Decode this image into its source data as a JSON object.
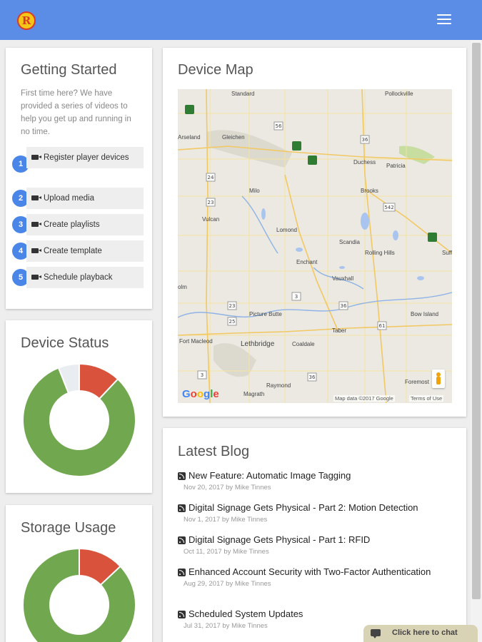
{
  "header": {
    "logo_letter": "R",
    "brand_color": "#5b8de6",
    "menu_icon": "hamburger-menu-icon"
  },
  "getting_started": {
    "title": "Getting Started",
    "description": "First time here? We have provided a series of videos to help you get up and running in no time.",
    "steps": [
      {
        "number": "1",
        "label": "Register player devices"
      },
      {
        "number": "2",
        "label": "Upload media"
      },
      {
        "number": "3",
        "label": "Create playlists"
      },
      {
        "number": "4",
        "label": "Create template"
      },
      {
        "number": "5",
        "label": "Schedule playback"
      }
    ]
  },
  "device_status": {
    "title": "Device Status",
    "segments": [
      {
        "fraction": 0.12,
        "color": "#d9533c"
      },
      {
        "fraction": 0.82,
        "color": "#71a84f"
      },
      {
        "fraction": 0.06,
        "color": "#e9ecf0"
      }
    ]
  },
  "storage_usage": {
    "title": "Storage Usage",
    "segments": [
      {
        "fraction": 0.13,
        "color": "#d9533c"
      },
      {
        "fraction": 0.87,
        "color": "#71a84f"
      }
    ]
  },
  "device_map": {
    "title": "Device Map",
    "towns": [
      "Standard",
      "Pollockville",
      "Gleichen",
      "Duchess",
      "Patricia",
      "Milo",
      "Brooks",
      "Vulcan",
      "Lomond",
      "Scandia",
      "Rolling Hills",
      "Enchant",
      "Vauxhall",
      "Picture Butte",
      "Bow Island",
      "Taber",
      "Lethbridge",
      "Coaldale",
      "Raymond",
      "Magrath",
      "Fort Macleod",
      "Foremost",
      "Arseland",
      "Suff",
      "olm"
    ],
    "highway_numbers": [
      "56",
      "36",
      "24",
      "23",
      "542",
      "3",
      "36",
      "23",
      "25",
      "3",
      "61",
      "36"
    ],
    "google_logo": "Google",
    "map_data": "Map data ©2017 Google",
    "terms": "Terms of Use"
  },
  "latest_blog": {
    "title": "Latest Blog",
    "posts": [
      {
        "title": "New Feature: Automatic Image Tagging",
        "meta": "Nov 20, 2017 by Mike Tinnes"
      },
      {
        "title": "Digital Signage Gets Physical - Part 2: Motion Detection",
        "meta": "Nov 1, 2017 by Mike Tinnes"
      },
      {
        "title": "Digital Signage Gets Physical - Part 1: RFID",
        "meta": "Oct 11, 2017 by Mike Tinnes"
      },
      {
        "title": "Enhanced Account Security with Two-Factor Authentication",
        "meta": "Aug 29, 2017 by Mike Tinnes"
      },
      {
        "title": "Scheduled System Updates",
        "meta": "Jul 31, 2017 by Mike Tinnes"
      }
    ]
  },
  "chat": {
    "label": "Click here to chat"
  }
}
